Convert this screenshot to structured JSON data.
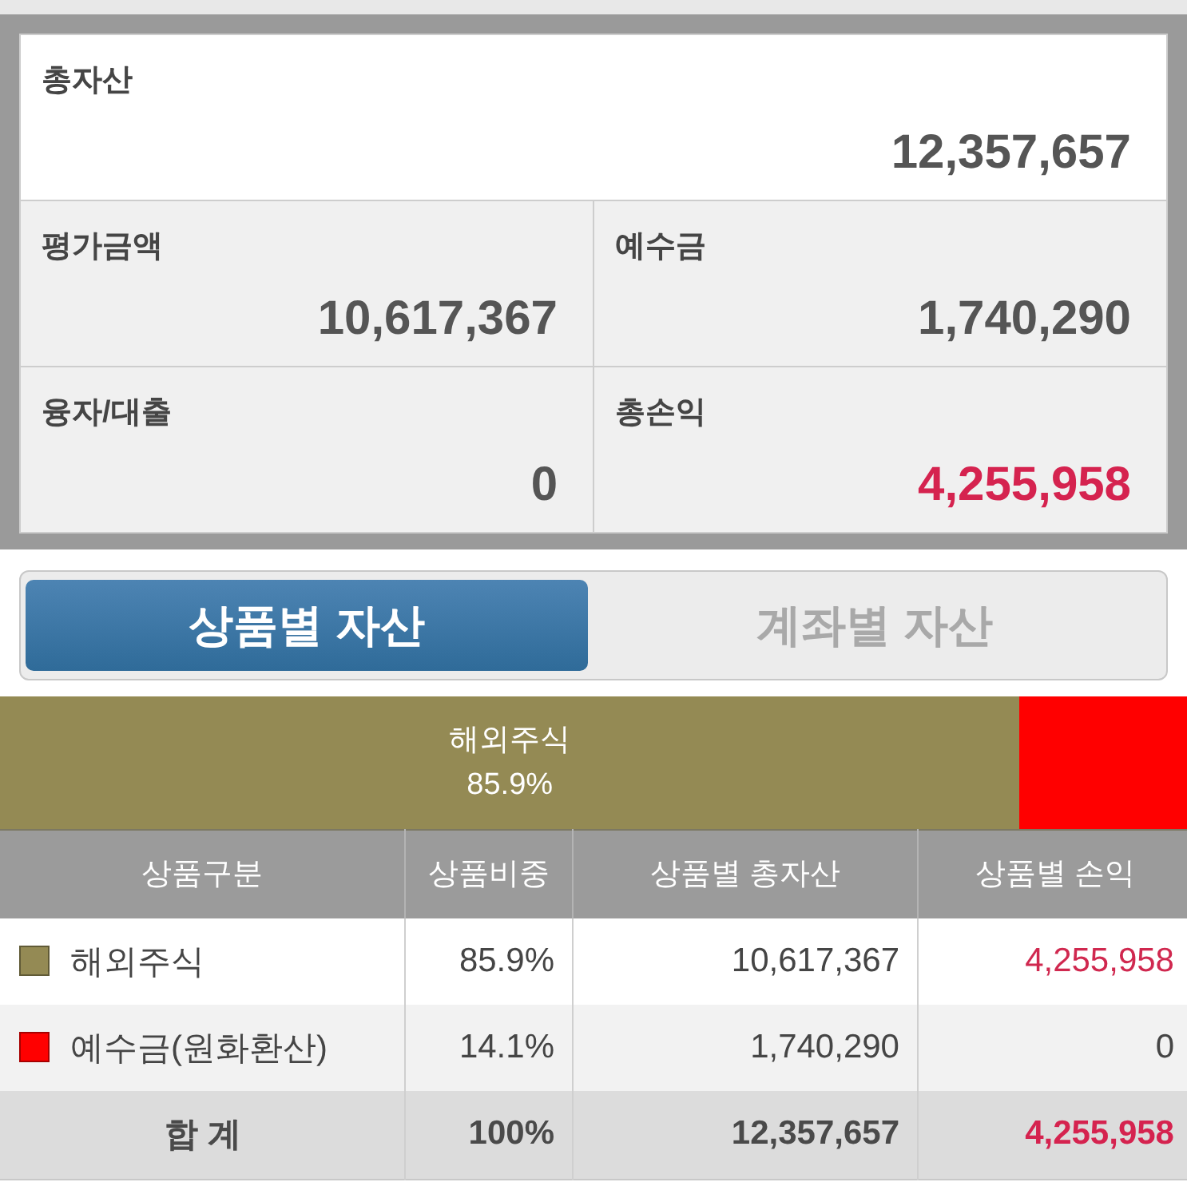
{
  "summary": {
    "total": {
      "label": "총자산",
      "value": "12,357,657"
    },
    "cells": [
      {
        "label": "평가금액",
        "value": "10,617,367",
        "gain": false
      },
      {
        "label": "예수금",
        "value": "1,740,290",
        "gain": false
      },
      {
        "label": "융자/대출",
        "value": "0",
        "gain": false
      },
      {
        "label": "총손익",
        "value": "4,255,958",
        "gain": true
      }
    ]
  },
  "tabs": [
    {
      "label": "상품별 자산",
      "selected": true
    },
    {
      "label": "계좌별 자산",
      "selected": false
    }
  ],
  "allocation_bar": {
    "segments": [
      {
        "label": "해외주식",
        "share": "85.9%",
        "level": 0.859,
        "color": "#948a54"
      },
      {
        "level": 0.141,
        "color": "#ff0000"
      }
    ]
  },
  "table": {
    "columns": [
      "상품구분",
      "상품비중",
      "상품별 총자산",
      "상품별 손익"
    ],
    "rows": [
      {
        "kind": "item",
        "color": "#948a54",
        "cells": [
          "해외주식",
          "85.9%",
          "10,617,367",
          "4,255,958"
        ],
        "gain": true
      },
      {
        "kind": "item",
        "color": "#ff0000",
        "cells": [
          "예수금(원화환산)",
          "14.1%",
          "1,740,290",
          "0"
        ],
        "gain": false
      },
      {
        "kind": "total",
        "cells": [
          "합 계",
          "100%",
          "12,357,657",
          "4,255,958"
        ],
        "gain": true
      }
    ]
  }
}
